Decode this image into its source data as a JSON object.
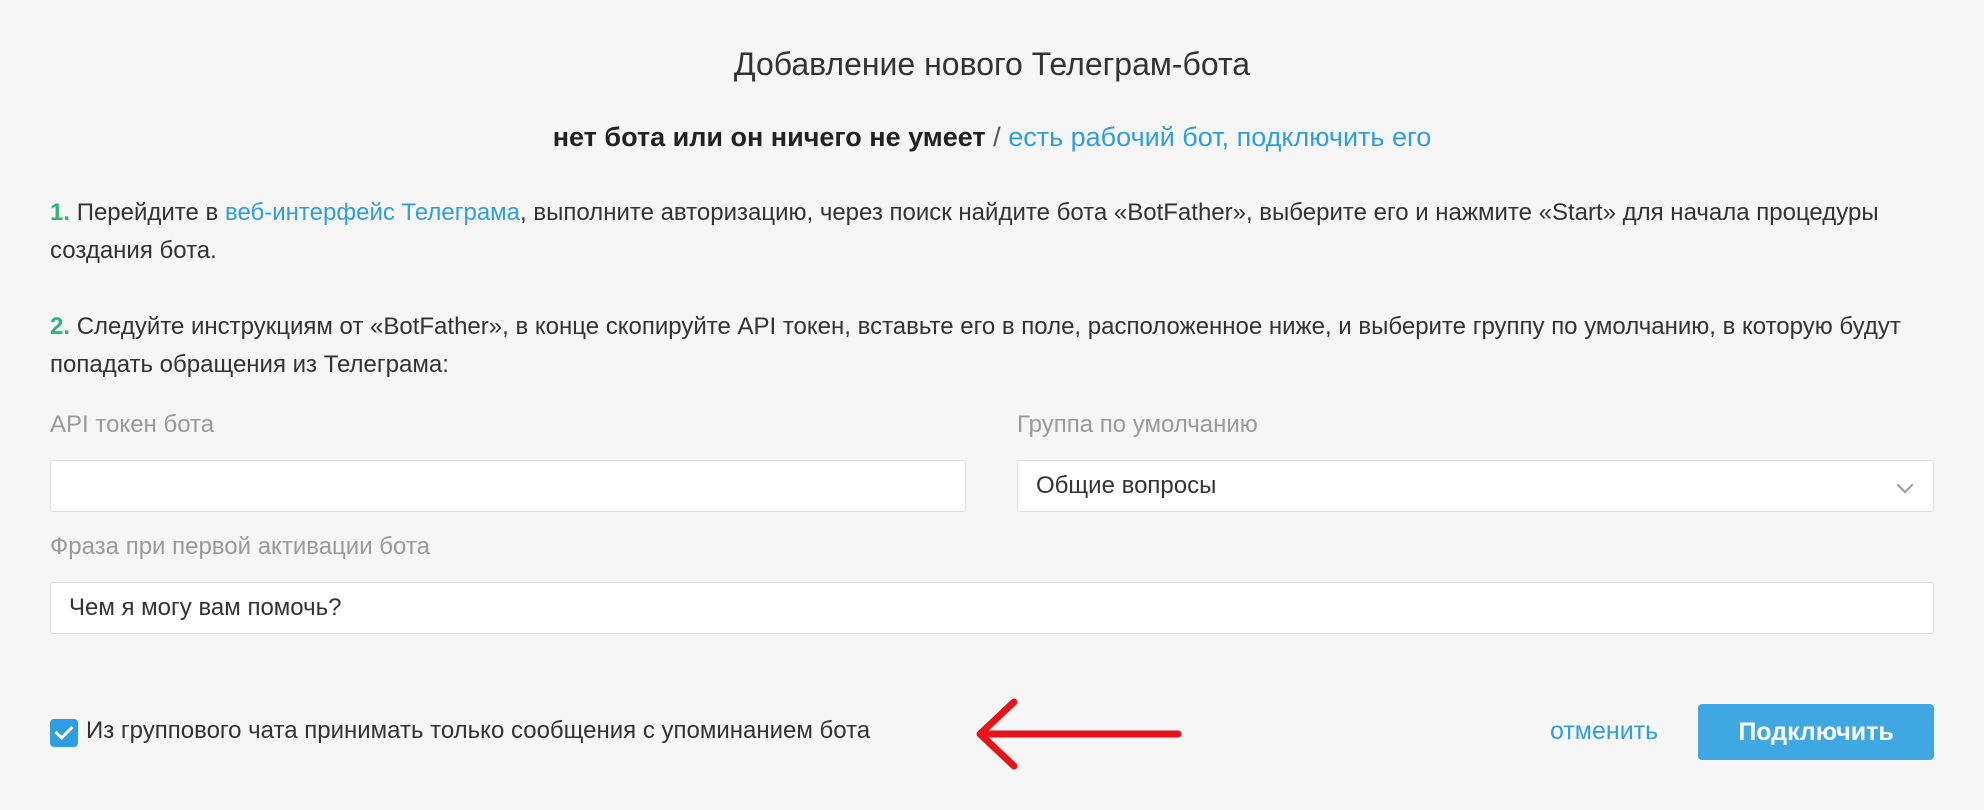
{
  "dialog": {
    "title": "Добавление нового Телеграм-бота",
    "mode_current": "нет бота или он ничего не умеет",
    "mode_separator": "/",
    "mode_alternative": "есть рабочий бот, подключить его"
  },
  "steps": [
    {
      "number": "1.",
      "text_before": "Перейдите в",
      "link": "веб-интерфейс Телеграма",
      "text_after": ", выполните авторизацию, через поиск найдите бота «BotFather», выберите его и нажмите «Start» для начала процедуры создания бота."
    },
    {
      "number": "2.",
      "text": "Следуйте инструкциям от «BotFather», в конце скопируйте API токен, вставьте его в поле, расположенное ниже, и выберите группу по умолчанию, в которую будут попадать обращения из Телеграма:"
    }
  ],
  "form": {
    "token": {
      "label": "API токен бота",
      "value": ""
    },
    "group": {
      "label": "Группа по умолчанию",
      "selected": "Общие вопросы"
    },
    "phrase": {
      "label": "Фраза при первой активации бота",
      "value": "Чем я могу вам помочь?"
    },
    "mention_only": {
      "label": "Из группового чата принимать только сообщения с упоминанием бота",
      "checked": true
    }
  },
  "actions": {
    "cancel_label": "отменить",
    "submit_label": "Подключить"
  },
  "colors": {
    "background": "#f6f6f6",
    "link": "#2f9ee0",
    "step_number": "#2bb673",
    "primary_button": "#3fa7e1",
    "annotation_arrow": "#e8141b"
  },
  "icons": {
    "select_toggle": "chevron-down-icon",
    "checkbox_mark": "check-icon",
    "annotation": "arrow-left-icon"
  }
}
